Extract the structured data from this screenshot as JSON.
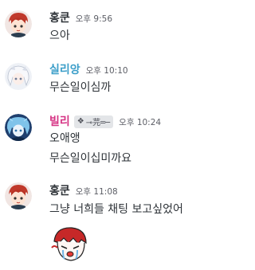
{
  "messages": [
    {
      "author": "홍쿤",
      "author_color": "#2e3338",
      "time": "오후 9:56",
      "lines": [
        "으아"
      ]
    },
    {
      "author": "실리앙",
      "author_color": "#3b9ec9",
      "time": "오후 10:10",
      "lines": [
        "무슨일이심까"
      ]
    },
    {
      "author": "빌리",
      "author_color": "#d63384",
      "time": "오후 10:24",
      "tag": {
        "icon": "diamond-sparkle-icon",
        "text": "⊸芫═─"
      },
      "lines": [
        "오애앵",
        "무슨일이십미까요"
      ]
    },
    {
      "author": "홍쿤",
      "author_color": "#2e3338",
      "time": "오후 11:08",
      "lines": [
        "그냥 너희들 채팅 보고싶었어"
      ],
      "sticker": "crying-character-sticker"
    }
  ]
}
